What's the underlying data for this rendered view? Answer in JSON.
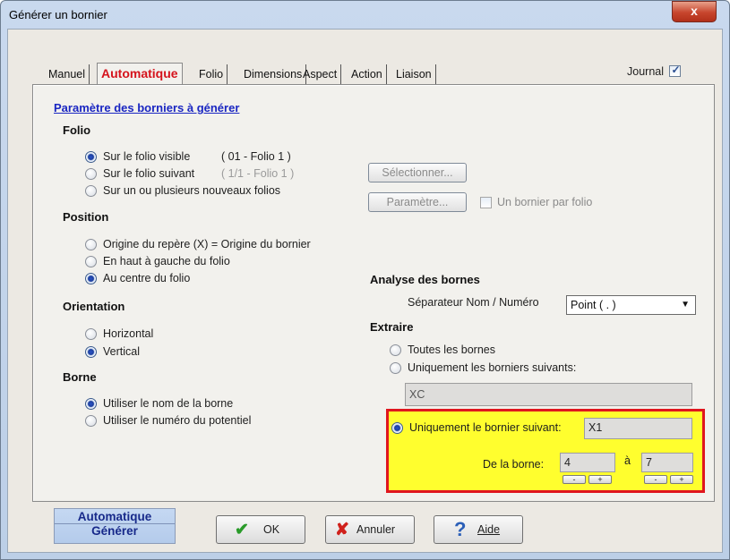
{
  "window": {
    "title": "Générer un bornier",
    "close_glyph": "x"
  },
  "tabs": [
    {
      "label": "Manuel"
    },
    {
      "label": "Automatique"
    },
    {
      "label": "Folio"
    },
    {
      "label": "Dimensions"
    },
    {
      "label": "Aspect"
    },
    {
      "label": "Action"
    },
    {
      "label": "Liaison"
    }
  ],
  "journal": {
    "label": "Journal",
    "checked": true
  },
  "section_link": "Paramètre des borniers à générer",
  "folio": {
    "header": "Folio",
    "opt_visible": "Sur le folio visible",
    "opt_visible_info": "( 01 - Folio 1 )",
    "opt_next": "Sur le folio suivant",
    "opt_next_info": "( 1/1 - Folio 1 )",
    "opt_new": "Sur un ou plusieurs nouveaux folios",
    "btn_select": "Sélectionner...",
    "btn_param": "Paramètre...",
    "one_per_folio": "Un bornier par folio"
  },
  "position": {
    "header": "Position",
    "opt_origin": "Origine du repère (X) = Origine du bornier",
    "opt_top_left": "En haut à gauche du folio",
    "opt_center": "Au centre du folio"
  },
  "orientation": {
    "header": "Orientation",
    "opt_horizontal": "Horizontal",
    "opt_vertical": "Vertical"
  },
  "borne": {
    "header": "Borne",
    "opt_name": "Utiliser le nom de la borne",
    "opt_potential": "Utiliser le numéro du potentiel"
  },
  "analysis": {
    "header": "Analyse des bornes",
    "sep_label": "Séparateur Nom / Numéro",
    "sep_value": "Point ( . )"
  },
  "extract": {
    "header": "Extraire",
    "opt_all": "Toutes les bornes",
    "opt_following": "Uniquement les borniers suivants:",
    "following_value": "XC",
    "opt_single": "Uniquement le bornier suivant:",
    "single_value": "X1",
    "range_label": "De la borne:",
    "from_value": "4",
    "to_label": "à",
    "to_value": "7",
    "spin_minus": "-",
    "spin_plus": "+"
  },
  "footer": {
    "side_line1": "Automatique",
    "side_line2": "Générer",
    "ok_label": "OK",
    "cancel_label": "Annuler",
    "help_label": "Aide"
  },
  "colors": {
    "accent_red": "#d5131c",
    "highlight_yellow": "#fffe2e",
    "link_blue": "#1a26c2"
  }
}
